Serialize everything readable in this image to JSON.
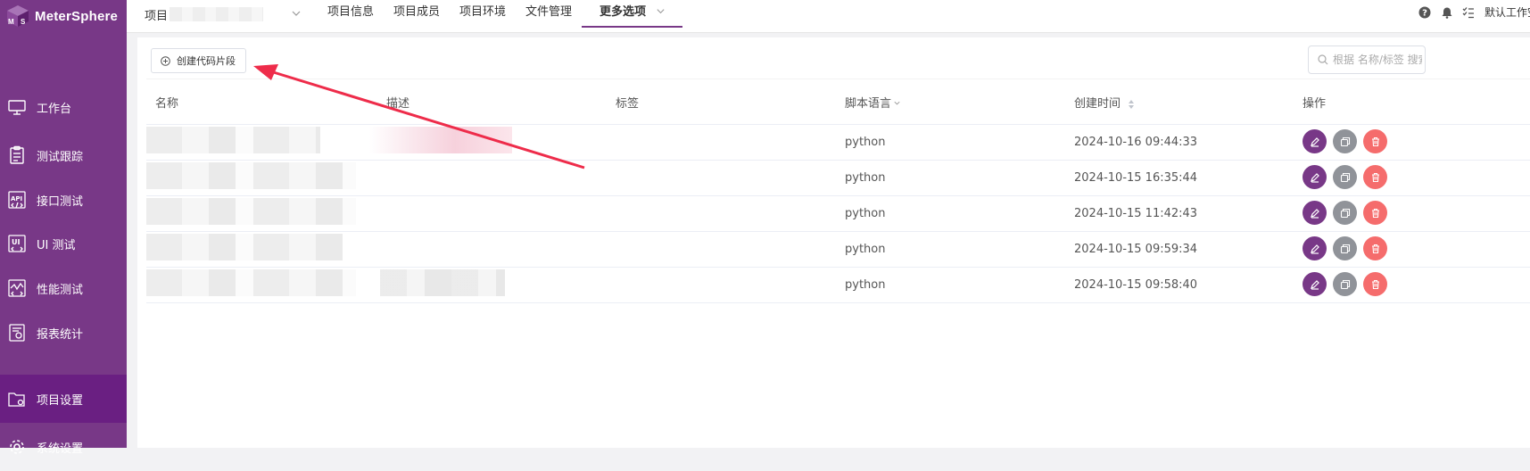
{
  "brand": {
    "name": "MeterSphere"
  },
  "sidebar": {
    "items": [
      {
        "label": "工作台",
        "icon": "monitor-icon"
      },
      {
        "label": "测试跟踪",
        "icon": "clipboard-icon"
      },
      {
        "label": "接口测试",
        "icon": "api-icon"
      },
      {
        "label": "UI 测试",
        "icon": "ui-icon"
      },
      {
        "label": "性能测试",
        "icon": "performance-icon"
      },
      {
        "label": "报表统计",
        "icon": "report-icon"
      },
      {
        "label": "项目设置",
        "icon": "folder-settings-icon",
        "active": true
      },
      {
        "label": "系统设置",
        "icon": "gear-icon"
      }
    ]
  },
  "header": {
    "project_prefix": "项目",
    "tabs": [
      "项目信息",
      "项目成员",
      "项目环境",
      "文件管理",
      "更多选项"
    ],
    "active_tab": "更多选项",
    "workspace_label": "默认工作空间"
  },
  "toolbar": {
    "create_button": "创建代码片段",
    "search_placeholder": "根据 名称/标签 搜索"
  },
  "table": {
    "columns": [
      "名称",
      "描述",
      "标签",
      "脚本语言",
      "创建时间",
      "操作"
    ],
    "rows": [
      {
        "language": "python",
        "created": "2024-10-16 09:44:33"
      },
      {
        "language": "python",
        "created": "2024-10-15 16:35:44"
      },
      {
        "language": "python",
        "created": "2024-10-15 11:42:43"
      },
      {
        "language": "python",
        "created": "2024-10-15 09:59:34"
      },
      {
        "language": "python",
        "created": "2024-10-15 09:58:40"
      }
    ]
  },
  "colors": {
    "brand": "#783887",
    "sidebar_active": "#6a1f82",
    "edit_button": "#783887",
    "copy_button": "#909399",
    "delete_button": "#f56c6c",
    "annotation_arrow": "#ee2c4a"
  }
}
